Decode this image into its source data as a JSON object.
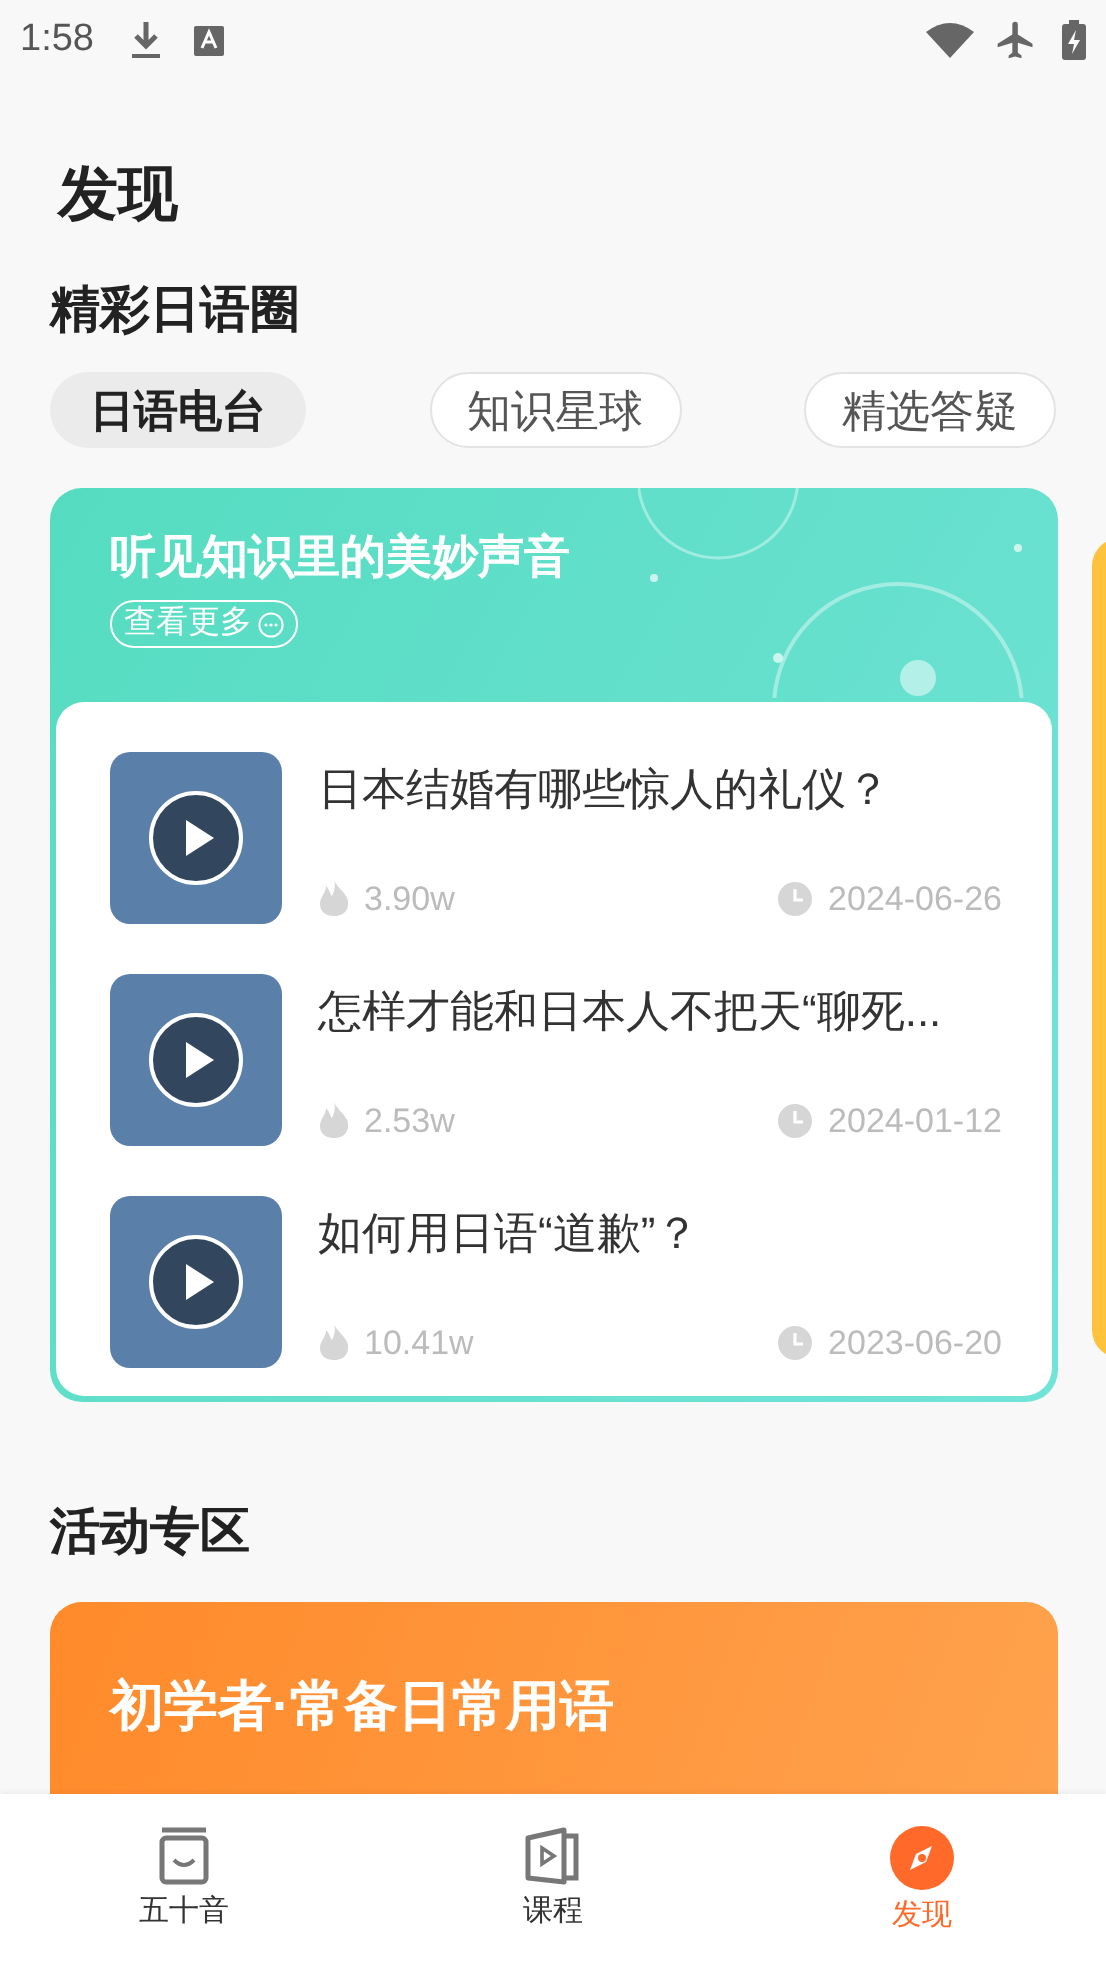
{
  "status_bar": {
    "time": "1:58"
  },
  "page_title": "发现",
  "section_title": "精彩日语圈",
  "tabs": [
    {
      "label": "日语电台",
      "selected": true
    },
    {
      "label": "知识星球",
      "selected": false
    },
    {
      "label": "精选答疑",
      "selected": false
    }
  ],
  "radio_card": {
    "title": "听见知识里的美妙声音",
    "more_label": "查看更多",
    "items": [
      {
        "title": "日本结婚有哪些惊人的礼仪？",
        "views": "3.90w",
        "date": "2024-06-26"
      },
      {
        "title": "怎样才能和日本人不把天“聊死...",
        "views": "2.53w",
        "date": "2024-01-12"
      },
      {
        "title": "如何用日语“道歉”？",
        "views": "10.41w",
        "date": "2023-06-20"
      }
    ]
  },
  "activity_section": {
    "title": "活动专区",
    "banner_title": "初学者·常备日常用语"
  },
  "bottom_nav": [
    {
      "label": "五十音",
      "kind": "kana",
      "selected": false
    },
    {
      "label": "课程",
      "kind": "course",
      "selected": false
    },
    {
      "label": "发现",
      "kind": "discover",
      "selected": true
    }
  ]
}
